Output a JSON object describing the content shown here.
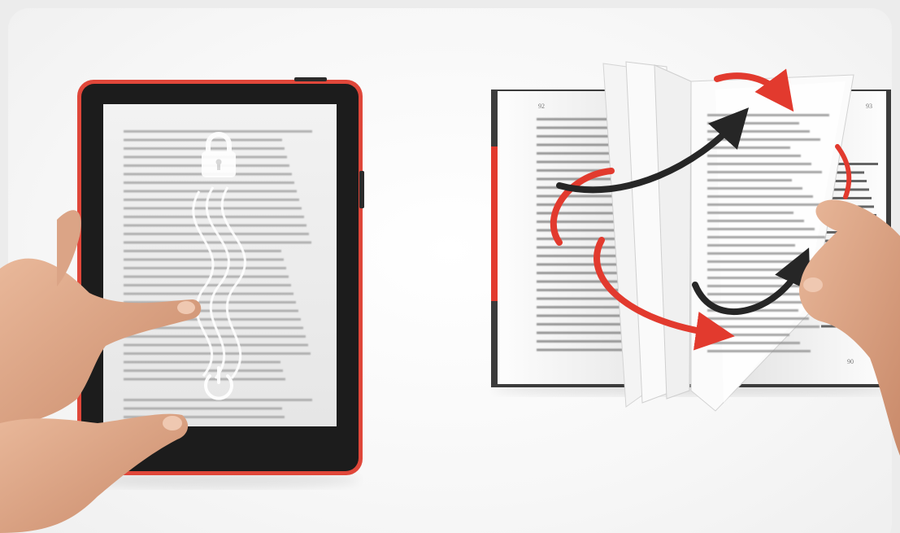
{
  "image": {
    "alt": "",
    "left_panel": {
      "subject": "e-reader",
      "icons": [
        "lock-icon",
        "power-icon"
      ],
      "accent_color": "#e0473a",
      "screen_color": "#efefef",
      "bezel_color": "#1c1c1c"
    },
    "right_panel": {
      "subject": "paper-book",
      "page_numbers": {
        "left": "92",
        "right": "93",
        "bottom_right": "90"
      },
      "accent_color": "#e23a2e",
      "arrow_dark_color": "#262626"
    }
  }
}
